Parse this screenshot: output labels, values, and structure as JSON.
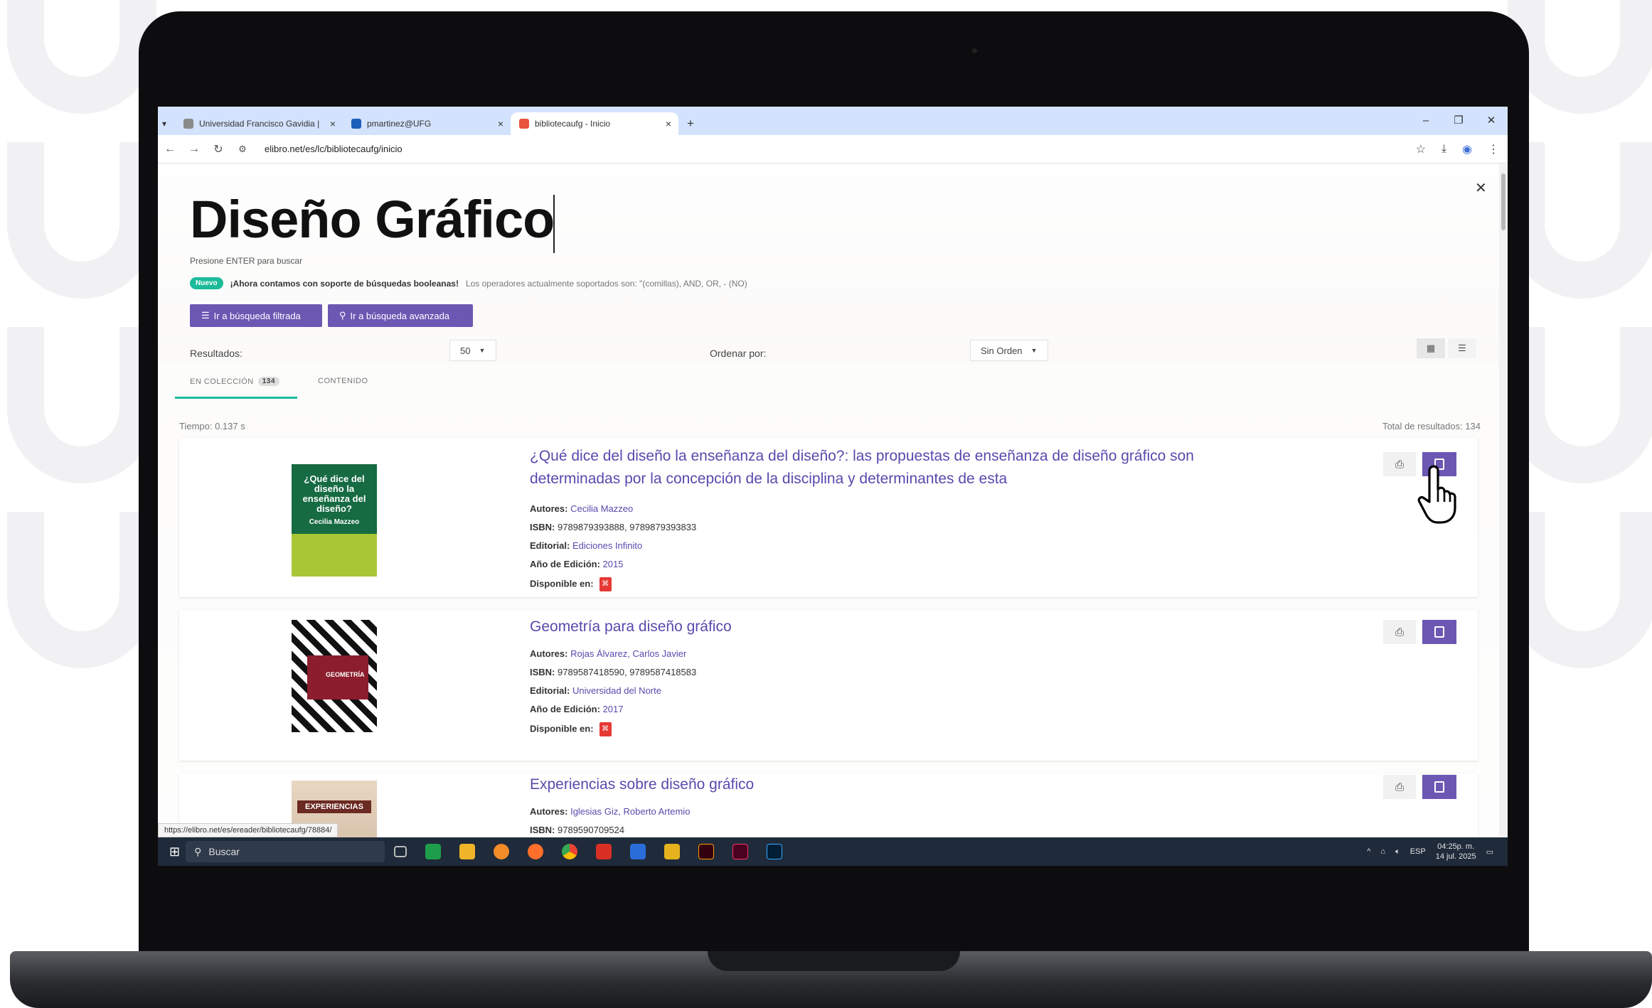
{
  "browser": {
    "tabs": [
      {
        "label": "Universidad Francisco Gavidia |"
      },
      {
        "label": "pmartinez@UFG"
      },
      {
        "label": "bibliotecaufg - Inicio"
      }
    ],
    "url": "elibro.net/es/lc/bibliotecaufg/inicio",
    "status_url": "https://elibro.net/es/ereader/bibliotecaufg/78884/"
  },
  "search": {
    "query": "Diseño Gráfico",
    "hint": "Presione ENTER para buscar",
    "notice_badge": "Nuevo",
    "notice_bold": "¡Ahora contamos con soporte de búsquedas booleanas!",
    "notice_ops": "Los operadores actualmente soportados son: \"(comillas), AND, OR, - (NO)",
    "filtered_btn": "Ir a búsqueda filtrada",
    "advanced_btn": "Ir a búsqueda avanzada",
    "results_label": "Resultados:",
    "results_per_page": "50",
    "order_label": "Ordenar por:",
    "order_value": "Sin Orden",
    "tab_collection": "EN COLECCIÓN",
    "tab_collection_count": "134",
    "tab_content": "CONTENIDO",
    "time": "Tiempo: 0.137 s",
    "total": "Total de resultados: 134"
  },
  "labels": {
    "authors": "Autores:",
    "isbn": "ISBN:",
    "publisher": "Editorial:",
    "year": "Año de Edición:",
    "available": "Disponible en:"
  },
  "results": [
    {
      "title": "¿Qué dice del diseño la enseñanza del diseño?: las propuestas de enseñanza de diseño gráfico son determinadas por la concepción de la disciplina y determinantes de esta",
      "authors": "Cecilia Mazzeo",
      "isbn": "9789879393888, 9789879393833",
      "publisher": "Ediciones Infinito",
      "year": "2015",
      "cover_text": "¿Qué dice del diseño la enseñanza del diseño?",
      "cover_author": "Cecilia Mazzeo"
    },
    {
      "title": "Geometría para diseño gráfico",
      "authors": "Rojas Álvarez, Carlos Javier",
      "isbn": "9789587418590, 9789587418583",
      "publisher": "Universidad del Norte",
      "year": "2017",
      "cover_text": "GEOMETRÍA"
    },
    {
      "title": "Experiencias sobre diseño gráfico",
      "authors": "Iglesias Giz, Roberto Artemio",
      "isbn": "9789590709524",
      "cover_text": "EXPERIENCIAS"
    }
  ],
  "taskbar": {
    "search": "Buscar",
    "lang": "ESP",
    "time": "04:25p. m.",
    "date": "14 jul. 2025"
  },
  "colors": {
    "accent": "#6c57b3",
    "new_badge": "#1cbb9a",
    "taskbar": "#1f2a3a"
  }
}
